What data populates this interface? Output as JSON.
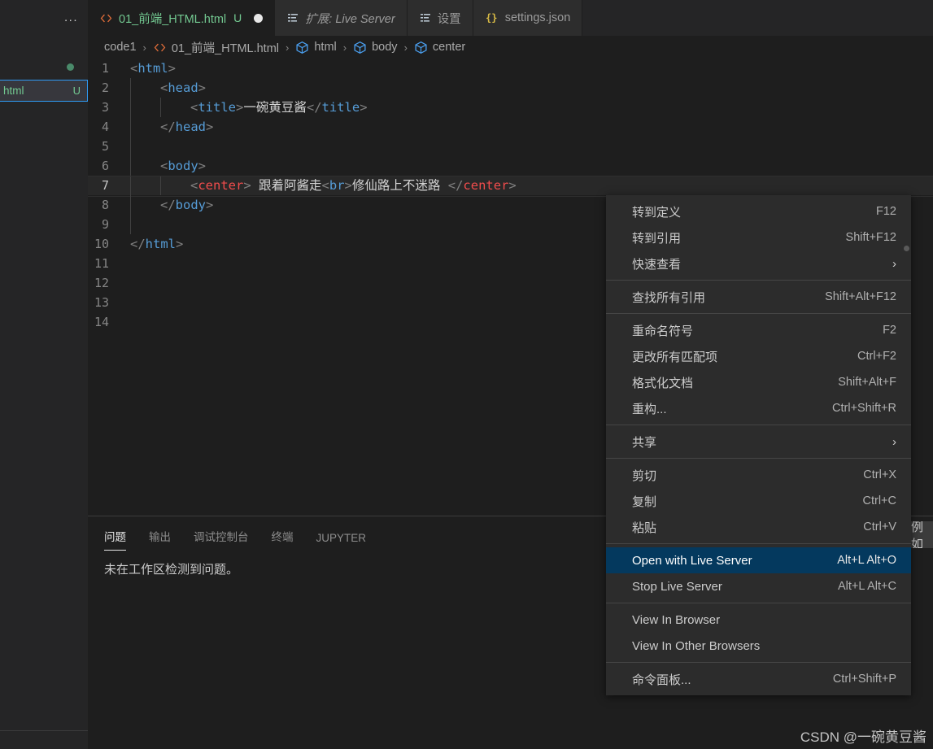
{
  "window": {
    "theme": "Dark+ (default dark)",
    "accent_hex": "#04395e",
    "bg_hex": "#1e1e1e",
    "sidebar_bg_hex": "#252526",
    "menu_bg_hex": "#2c2c2c"
  },
  "sidebar": {
    "overflow_menu_label": "...",
    "file": {
      "name_fragment": "html",
      "git_badge": "U",
      "color_hex": "#73c991"
    }
  },
  "tabs": [
    {
      "label": "01_前端_HTML.html",
      "badge": "U",
      "icon": "html-file-icon",
      "active": true,
      "dirty": true,
      "italic": false
    },
    {
      "label": "扩展: Live Server",
      "badge": "",
      "icon": "extensions-icon",
      "active": false,
      "dirty": false,
      "italic": true
    },
    {
      "label": "设置",
      "badge": "",
      "icon": "settings-page-icon",
      "active": false,
      "dirty": false,
      "italic": false
    },
    {
      "label": "settings.json",
      "badge": "",
      "icon": "json-file-icon",
      "active": false,
      "dirty": false,
      "italic": false
    }
  ],
  "breadcrumb": {
    "separator": "›",
    "items": [
      {
        "label": "code1",
        "icon": ""
      },
      {
        "label": "01_前端_HTML.html",
        "icon": "html-file-icon"
      },
      {
        "label": "html",
        "icon": "symbol-field-icon"
      },
      {
        "label": "body",
        "icon": "symbol-field-icon"
      },
      {
        "label": "center",
        "icon": "symbol-field-icon"
      }
    ]
  },
  "editor": {
    "language": "html",
    "current_line": 7,
    "total_lines": 14,
    "lines": [
      {
        "n": "1",
        "indent": 0,
        "guides": 0,
        "tokens": [
          {
            "t": "punct",
            "v": "<"
          },
          {
            "t": "tag",
            "v": "html"
          },
          {
            "t": "punct",
            "v": ">"
          }
        ]
      },
      {
        "n": "2",
        "indent": 1,
        "guides": 1,
        "tokens": [
          {
            "t": "punct",
            "v": "<"
          },
          {
            "t": "tag",
            "v": "head"
          },
          {
            "t": "punct",
            "v": ">"
          }
        ]
      },
      {
        "n": "3",
        "indent": 2,
        "guides": 2,
        "tokens": [
          {
            "t": "punct",
            "v": "<"
          },
          {
            "t": "tag",
            "v": "title"
          },
          {
            "t": "punct",
            "v": ">"
          },
          {
            "t": "text",
            "v": "一碗黄豆酱"
          },
          {
            "t": "punct",
            "v": "</"
          },
          {
            "t": "tag",
            "v": "title"
          },
          {
            "t": "punct",
            "v": ">"
          }
        ]
      },
      {
        "n": "4",
        "indent": 1,
        "guides": 1,
        "tokens": [
          {
            "t": "punct",
            "v": "</"
          },
          {
            "t": "tag",
            "v": "head"
          },
          {
            "t": "punct",
            "v": ">"
          }
        ]
      },
      {
        "n": "5",
        "indent": 0,
        "guides": 1,
        "tokens": []
      },
      {
        "n": "6",
        "indent": 1,
        "guides": 1,
        "tokens": [
          {
            "t": "punct",
            "v": "<"
          },
          {
            "t": "tag",
            "v": "body"
          },
          {
            "t": "punct",
            "v": ">"
          }
        ]
      },
      {
        "n": "7",
        "indent": 2,
        "guides": 2,
        "tokens": [
          {
            "t": "punct",
            "v": "<"
          },
          {
            "t": "tagr",
            "v": "center"
          },
          {
            "t": "punct",
            "v": ">"
          },
          {
            "t": "text",
            "v": " 跟着阿酱走"
          },
          {
            "t": "punct",
            "v": "<"
          },
          {
            "t": "tag",
            "v": "br"
          },
          {
            "t": "punct",
            "v": ">"
          },
          {
            "t": "text",
            "v": "修仙路上不迷路 "
          },
          {
            "t": "punct",
            "v": "</"
          },
          {
            "t": "tagr",
            "v": "center"
          },
          {
            "t": "punct",
            "v": ">"
          }
        ]
      },
      {
        "n": "8",
        "indent": 1,
        "guides": 1,
        "tokens": [
          {
            "t": "punct",
            "v": "</"
          },
          {
            "t": "tag",
            "v": "body"
          },
          {
            "t": "punct",
            "v": ">"
          }
        ]
      },
      {
        "n": "9",
        "indent": 0,
        "guides": 1,
        "tokens": []
      },
      {
        "n": "10",
        "indent": 0,
        "guides": 0,
        "tokens": [
          {
            "t": "punct",
            "v": "</"
          },
          {
            "t": "tag",
            "v": "html"
          },
          {
            "t": "punct",
            "v": ">"
          }
        ]
      },
      {
        "n": "11",
        "indent": 0,
        "guides": 0,
        "tokens": []
      },
      {
        "n": "12",
        "indent": 0,
        "guides": 0,
        "tokens": []
      },
      {
        "n": "13",
        "indent": 0,
        "guides": 0,
        "tokens": []
      },
      {
        "n": "14",
        "indent": 0,
        "guides": 0,
        "tokens": []
      }
    ]
  },
  "panel": {
    "tabs": [
      {
        "label": "问题",
        "active": true
      },
      {
        "label": "输出",
        "active": false
      },
      {
        "label": "调试控制台",
        "active": false
      },
      {
        "label": "终端",
        "active": false
      },
      {
        "label": "JUPYTER",
        "active": false
      }
    ],
    "message": "未在工作区检测到问题。"
  },
  "context_menu": {
    "groups": [
      {
        "items": [
          {
            "label": "转到定义",
            "key": "F12",
            "submenu": false,
            "highlight": false
          },
          {
            "label": "转到引用",
            "key": "Shift+F12",
            "submenu": false,
            "highlight": false
          },
          {
            "label": "快速查看",
            "key": "",
            "submenu": true,
            "highlight": false
          }
        ]
      },
      {
        "items": [
          {
            "label": "查找所有引用",
            "key": "Shift+Alt+F12",
            "submenu": false,
            "highlight": false
          }
        ]
      },
      {
        "items": [
          {
            "label": "重命名符号",
            "key": "F2",
            "submenu": false,
            "highlight": false
          },
          {
            "label": "更改所有匹配项",
            "key": "Ctrl+F2",
            "submenu": false,
            "highlight": false
          },
          {
            "label": "格式化文档",
            "key": "Shift+Alt+F",
            "submenu": false,
            "highlight": false
          },
          {
            "label": "重构...",
            "key": "Ctrl+Shift+R",
            "submenu": false,
            "highlight": false
          }
        ]
      },
      {
        "items": [
          {
            "label": "共享",
            "key": "",
            "submenu": true,
            "highlight": false
          }
        ]
      },
      {
        "items": [
          {
            "label": "剪切",
            "key": "Ctrl+X",
            "submenu": false,
            "highlight": false
          },
          {
            "label": "复制",
            "key": "Ctrl+C",
            "submenu": false,
            "highlight": false
          },
          {
            "label": "粘贴",
            "key": "Ctrl+V",
            "submenu": false,
            "highlight": false
          }
        ]
      },
      {
        "items": [
          {
            "label": "Open with Live Server",
            "key": "Alt+L Alt+O",
            "submenu": false,
            "highlight": true
          },
          {
            "label": "Stop Live Server",
            "key": "Alt+L Alt+C",
            "submenu": false,
            "highlight": false
          }
        ]
      },
      {
        "items": [
          {
            "label": "View In Browser",
            "key": "",
            "submenu": false,
            "highlight": false
          },
          {
            "label": "View In Other Browsers",
            "key": "",
            "submenu": false,
            "highlight": false
          }
        ]
      },
      {
        "items": [
          {
            "label": "命令面板...",
            "key": "Ctrl+Shift+P",
            "submenu": false,
            "highlight": false
          }
        ]
      }
    ],
    "submenu_glyph": "›"
  },
  "tooltip_fragment": {
    "text": "例如"
  },
  "watermark": {
    "text": "CSDN @一碗黄豆酱"
  }
}
